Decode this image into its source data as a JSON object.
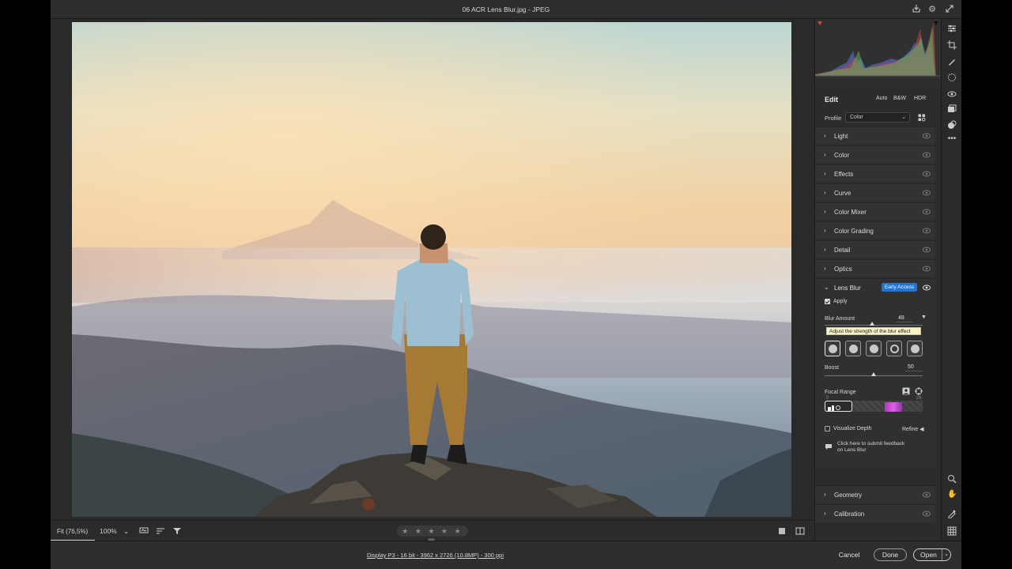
{
  "window": {
    "title": "06 ACR Lens Blur.jpg  -  JPEG"
  },
  "toolbar_bottom": {
    "fit_label": "Fit (76,5%)",
    "zoom_label": "100%",
    "rating": "★ ★ ★ ★ ★"
  },
  "status": {
    "info": "Display P3 - 16 bit - 3962 x 2726 (10.8MP) - 300 ppi"
  },
  "actions": {
    "cancel": "Cancel",
    "done": "Done",
    "open": "Open"
  },
  "edit": {
    "title": "Edit",
    "modes": [
      "Auto",
      "B&W",
      "HDR"
    ],
    "profile_label": "Profile",
    "profile_value": "Color"
  },
  "sections": [
    "Light",
    "Color",
    "Effects",
    "Curve",
    "Color Mixer",
    "Color Grading",
    "Detail",
    "Optics"
  ],
  "lens_blur": {
    "title": "Lens Blur",
    "badge": "Early Access",
    "apply_label": "Apply",
    "apply_checked": true,
    "blur_amount_label": "Blur Amount",
    "blur_amount_value": "48",
    "blur_amount_level": 0.48,
    "tooltip": "Adjust the strength of the blur effect",
    "boost_label": "Boost",
    "boost_value": "50",
    "boost_level": 0.5,
    "focal_range_label": "Focal Range",
    "focal_min": "0",
    "focal_max": "26",
    "visualize_depth_label": "Visualize Depth",
    "visualize_depth_checked": false,
    "refine_label": "Refine",
    "feedback_line1": "Click here to submit feedback",
    "feedback_line2": "on Lens Blur"
  },
  "sections_after": [
    "Geometry",
    "Calibration"
  ],
  "colors": {
    "accent": "#1f74d4",
    "panel_bg": "#2c2c2c",
    "section_bg": "#323232"
  }
}
